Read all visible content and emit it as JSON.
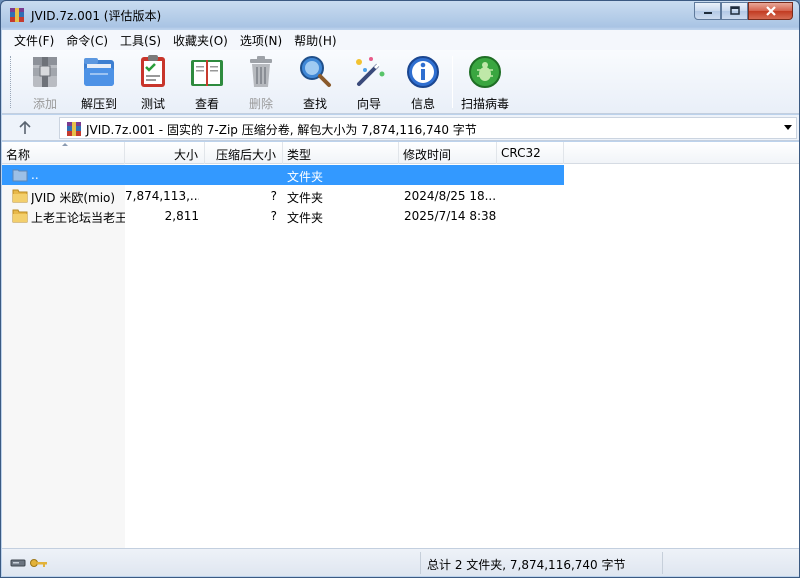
{
  "window": {
    "title": "JVID.7z.001 (评估版本)"
  },
  "menu": [
    "文件(F)",
    "命令(C)",
    "工具(S)",
    "收藏夹(O)",
    "选项(N)",
    "帮助(H)"
  ],
  "toolbar": {
    "add": "添加",
    "extract": "解压到",
    "test": "测试",
    "view": "查看",
    "delete": "删除",
    "find": "查找",
    "wizard": "向导",
    "info": "信息",
    "scan": "扫描病毒"
  },
  "address": {
    "text": "JVID.7z.001 - 固实的 7-Zip 压缩分卷, 解包大小为 7,874,116,740 字节"
  },
  "columns": {
    "name": "名称",
    "size": "大小",
    "packed": "压缩后大小",
    "type": "类型",
    "modified": "修改时间",
    "crc": "CRC32"
  },
  "rows": [
    {
      "name": "..",
      "size": "",
      "packed": "",
      "type": "文件夹",
      "modified": "",
      "crc": ""
    },
    {
      "name": "JVID 米欧(mio)",
      "size": "7,874,113,...",
      "packed": "?",
      "type": "文件夹",
      "modified": "2024/8/25 18...",
      "crc": ""
    },
    {
      "name": "上老王论坛当老王",
      "size": "2,811",
      "packed": "?",
      "type": "文件夹",
      "modified": "2025/7/14 8:38",
      "crc": ""
    }
  ],
  "status": {
    "total": "总计 2 文件夹, 7,874,116,740 字节"
  },
  "colors": {
    "selection": "#3399ff",
    "folder": "#e8b84a",
    "accent": "#3b5a82"
  }
}
